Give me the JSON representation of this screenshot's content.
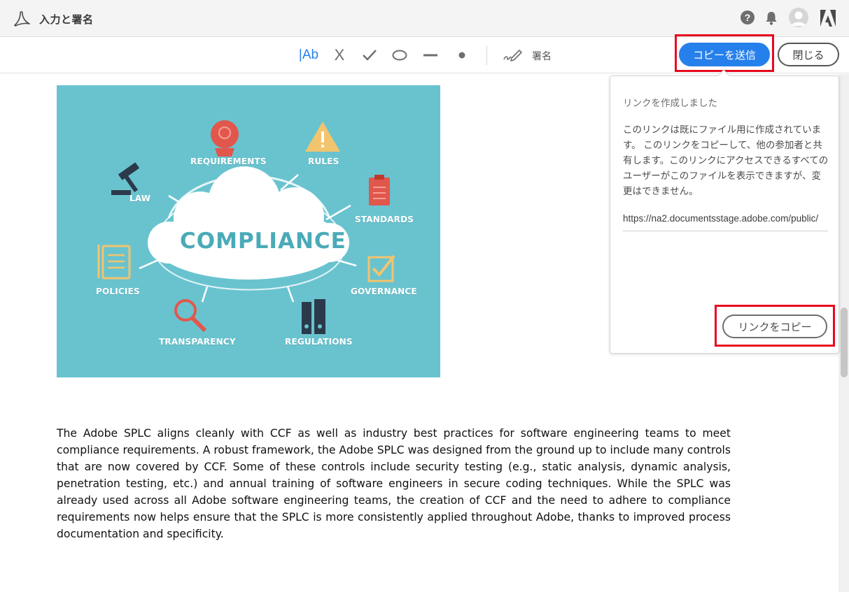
{
  "app": {
    "title": "入力と署名"
  },
  "header_icons": {
    "help": "?"
  },
  "toolbar": {
    "text_tool_label": "|Ab",
    "cross_tool_label": "X",
    "sign_label": "署名",
    "send_copy_label": "コピーを送信",
    "close_label": "閉じる"
  },
  "popover": {
    "title": "リンクを作成しました",
    "description": "このリンクは既にファイル用に作成されています。 このリンクをコピーして、他の参加者と共有します。このリンクにアクセスできるすべてのユーザーがこのファイルを表示できますが、変更はできません。",
    "url": "https://na2.documentsstage.adobe.com/public/",
    "copy_link_label": "リンクをコピー"
  },
  "document": {
    "illustration": {
      "center": "COMPLIANCE",
      "labels": {
        "requirements": "REQUIREMENTS",
        "rules": "RULES",
        "law": "LAW",
        "standards": "STANDARDS",
        "policies": "POLICIES",
        "governance": "GOVERNANCE",
        "transparency": "TRANSPARENCY",
        "regulations": "REGULATIONS"
      }
    },
    "paragraph": "The Adobe SPLC aligns cleanly with CCF as well as industry best practices for software engineering teams to meet compliance requirements. A robust framework, the Adobe SPLC was designed from the ground up to include many controls that are now covered by CCF. Some of these controls include security testing (e.g., static analysis, dynamic analysis, penetration testing, etc.) and annual training of software engineers in secure coding techniques. While the SPLC was already used across all Adobe software engineering teams, the creation of CCF and the need to adhere to compliance requirements now helps ensure that the SPLC is more consistently applied throughout Adobe, thanks to improved process documentation and specificity."
  },
  "colors": {
    "accent": "#2680eb",
    "highlight_frame": "#e8091e",
    "illustration_bg": "#69c3cf"
  }
}
